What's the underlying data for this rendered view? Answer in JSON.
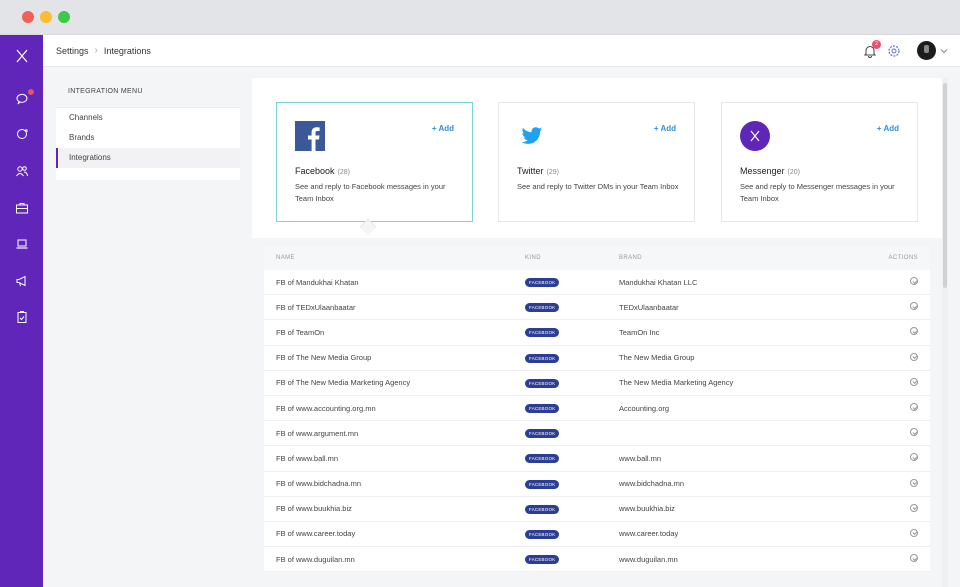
{
  "breadcrumb": {
    "root": "Settings",
    "current": "Integrations"
  },
  "notifications": {
    "count": "2"
  },
  "menu": {
    "title": "INTEGRATION MENU",
    "items": [
      {
        "label": "Channels"
      },
      {
        "label": "Brands"
      },
      {
        "label": "Integrations"
      }
    ]
  },
  "cards": [
    {
      "name": "Facebook",
      "count": "(28)",
      "add": "+ Add",
      "desc": "See and reply to Facebook messages in your Team Inbox",
      "icon": "facebook-icon"
    },
    {
      "name": "Twitter",
      "count": "(29)",
      "add": "+ Add",
      "desc": "See and reply to Twitter DMs in your Team Inbox",
      "icon": "twitter-icon"
    },
    {
      "name": "Messenger",
      "count": "(20)",
      "add": "+ Add",
      "desc": "See and reply to Messenger messages in your Team Inbox",
      "icon": "messenger-icon"
    }
  ],
  "table": {
    "headers": {
      "name": "NAME",
      "kind": "KIND",
      "brand": "BRAND",
      "actions": "ACTIONS"
    },
    "rows": [
      {
        "name": "FB of Mandukhai Khatan",
        "kind": "FACEBOOK",
        "brand": "Mandukhai Khatan LLC"
      },
      {
        "name": "FB of TEDxUlaanbaatar",
        "kind": "FACEBOOK",
        "brand": "TEDxUlaanbaatar"
      },
      {
        "name": "FB of TeamOn",
        "kind": "FACEBOOK",
        "brand": "TeamOn Inc"
      },
      {
        "name": "FB of The New Media Group",
        "kind": "FACEBOOK",
        "brand": "The New Media Group"
      },
      {
        "name": "FB of The New Media Marketing Agency",
        "kind": "FACEBOOK",
        "brand": "The New Media Marketing Agency"
      },
      {
        "name": "FB of www.accounting.org.mn",
        "kind": "FACEBOOK",
        "brand": "Accounting.org"
      },
      {
        "name": "FB of www.argument.mn",
        "kind": "FACEBOOK",
        "brand": ""
      },
      {
        "name": "FB of www.ball.mn",
        "kind": "FACEBOOK",
        "brand": "www.ball.mn"
      },
      {
        "name": "FB of www.bidchadna.mn",
        "kind": "FACEBOOK",
        "brand": "www.bidchadna.mn"
      },
      {
        "name": "FB of www.buukhia.biz",
        "kind": "FACEBOOK",
        "brand": "www.buukhia.biz"
      },
      {
        "name": "FB of www.career.today",
        "kind": "FACEBOOK",
        "brand": "www.career.today"
      },
      {
        "name": "FB of www.duguilan.mn",
        "kind": "FACEBOOK",
        "brand": "www.duguilan.mn"
      }
    ]
  },
  "colors": {
    "sidebar": "#5f26b9",
    "accent": "#2f8fd7",
    "tag": "#2c3e93",
    "badge": "#ea4f6a"
  }
}
